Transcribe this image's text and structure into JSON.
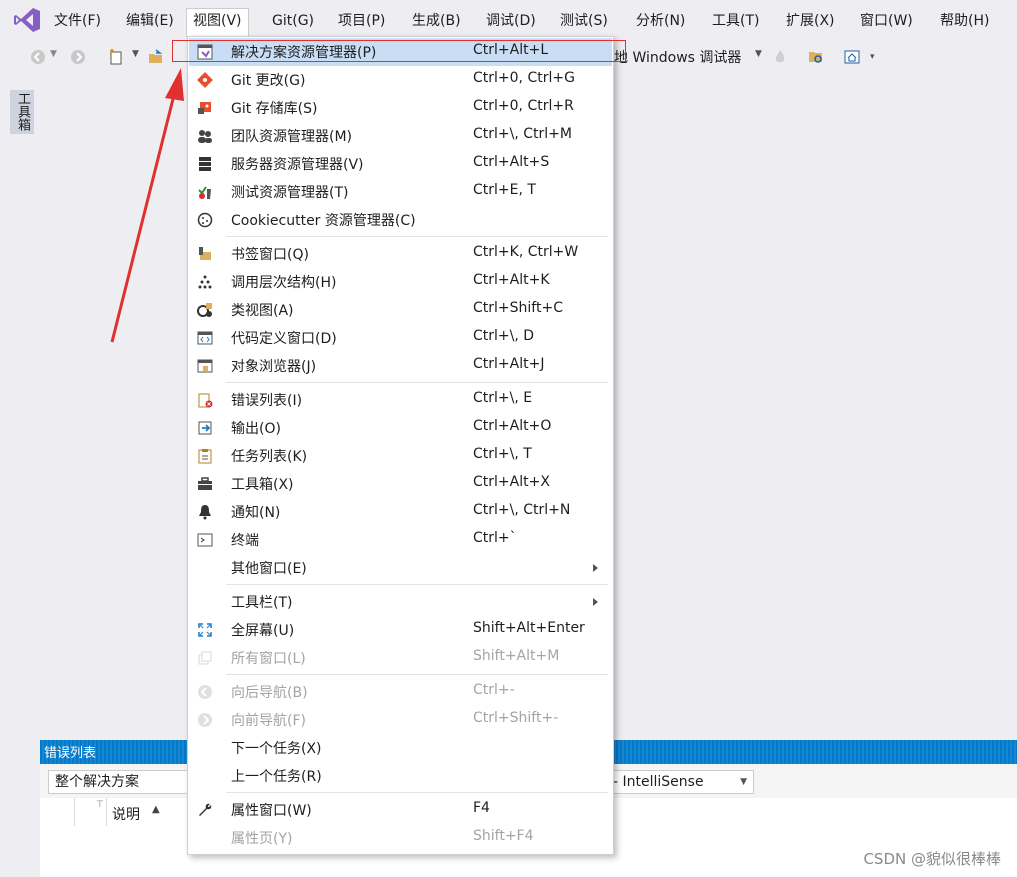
{
  "menubar": {
    "items": [
      "文件(F)",
      "编辑(E)",
      "视图(V)",
      "Git(G)",
      "项目(P)",
      "生成(B)",
      "调试(D)",
      "测试(S)",
      "分析(N)",
      "工具(T)",
      "扩展(X)",
      "窗口(W)",
      "帮助(H)"
    ],
    "open_index": 2
  },
  "toolbar": {
    "debug_target": "地 Windows 调试器"
  },
  "side_tab": {
    "label": "工具箱"
  },
  "menu": {
    "items": [
      {
        "label": "解决方案资源管理器(P)",
        "shortcut": "Ctrl+Alt+L",
        "icon": "solution-explorer-icon",
        "state": "highlighted"
      },
      {
        "label": "Git 更改(G)",
        "shortcut": "Ctrl+0, Ctrl+G",
        "icon": "git-changes-icon"
      },
      {
        "label": "Git 存储库(S)",
        "shortcut": "Ctrl+0, Ctrl+R",
        "icon": "git-repository-icon"
      },
      {
        "label": "团队资源管理器(M)",
        "shortcut": "Ctrl+\\, Ctrl+M",
        "icon": "team-explorer-icon"
      },
      {
        "label": "服务器资源管理器(V)",
        "shortcut": "Ctrl+Alt+S",
        "icon": "server-explorer-icon"
      },
      {
        "label": "测试资源管理器(T)",
        "shortcut": "Ctrl+E, T",
        "icon": "test-explorer-icon"
      },
      {
        "label": "Cookiecutter 资源管理器(C)",
        "shortcut": "",
        "icon": "cookiecutter-icon"
      },
      {
        "label": "书签窗口(Q)",
        "shortcut": "Ctrl+K, Ctrl+W",
        "icon": "bookmark-icon"
      },
      {
        "label": "调用层次结构(H)",
        "shortcut": "Ctrl+Alt+K",
        "icon": "call-hierarchy-icon"
      },
      {
        "label": "类视图(A)",
        "shortcut": "Ctrl+Shift+C",
        "icon": "class-view-icon"
      },
      {
        "label": "代码定义窗口(D)",
        "shortcut": "Ctrl+\\, D",
        "icon": "code-definition-icon"
      },
      {
        "label": "对象浏览器(J)",
        "shortcut": "Ctrl+Alt+J",
        "icon": "object-browser-icon"
      },
      {
        "label": "错误列表(I)",
        "shortcut": "Ctrl+\\, E",
        "icon": "error-list-icon"
      },
      {
        "label": "输出(O)",
        "shortcut": "Ctrl+Alt+O",
        "icon": "output-icon"
      },
      {
        "label": "任务列表(K)",
        "shortcut": "Ctrl+\\, T",
        "icon": "task-list-icon"
      },
      {
        "label": "工具箱(X)",
        "shortcut": "Ctrl+Alt+X",
        "icon": "toolbox-icon"
      },
      {
        "label": "通知(N)",
        "shortcut": "Ctrl+\\, Ctrl+N",
        "icon": "bell-icon"
      },
      {
        "label": "终端",
        "shortcut": "Ctrl+`",
        "icon": "terminal-icon"
      },
      {
        "label": "其他窗口(E)",
        "shortcut": "",
        "icon": "",
        "submenu": true
      },
      {
        "label": "工具栏(T)",
        "shortcut": "",
        "icon": "",
        "submenu": true
      },
      {
        "label": "全屏幕(U)",
        "shortcut": "Shift+Alt+Enter",
        "icon": "fullscreen-icon"
      },
      {
        "label": "所有窗口(L)",
        "shortcut": "Shift+Alt+M",
        "icon": "all-windows-icon",
        "state": "disabled"
      },
      {
        "label": "向后导航(B)",
        "shortcut": "Ctrl+-",
        "icon": "navigate-back-icon",
        "state": "disabled"
      },
      {
        "label": "向前导航(F)",
        "shortcut": "Ctrl+Shift+-",
        "icon": "navigate-forward-icon",
        "state": "disabled"
      },
      {
        "label": "下一个任务(X)",
        "shortcut": "",
        "icon": ""
      },
      {
        "label": "上一个任务(R)",
        "shortcut": "",
        "icon": ""
      },
      {
        "label": "属性窗口(W)",
        "shortcut": "F4",
        "icon": "wrench-icon"
      },
      {
        "label": "属性页(Y)",
        "shortcut": "Shift+F4",
        "icon": "",
        "state": "disabled"
      }
    ]
  },
  "error_panel": {
    "title": "错误列表",
    "scope": "整个解决方案",
    "source": "- IntelliSense",
    "column_description": "说明"
  },
  "watermark": "CSDN @貌似很棒棒",
  "colors": {
    "accent": "#007acc",
    "menu_highlight": "#c9def5",
    "annotation_red": "#e03030",
    "vs_purple": "#865fc5"
  }
}
